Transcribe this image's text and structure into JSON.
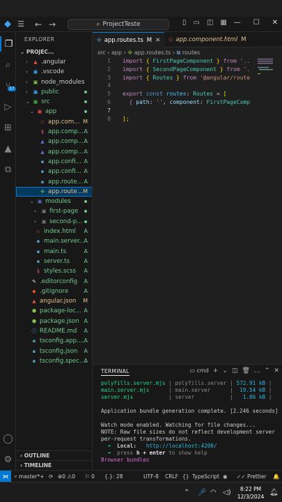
{
  "titlebar": {
    "search_text": "ProjectTeste"
  },
  "activity_bar": {
    "source_control_badge": "37"
  },
  "explorer": {
    "header": "EXPLORER",
    "project_label": "PROJEC...",
    "items": [
      {
        "label": ".angular",
        "status": ""
      },
      {
        "label": ".vscode",
        "status": ""
      },
      {
        "label": "node_modules",
        "status": ""
      },
      {
        "label": "public",
        "status": ""
      },
      {
        "label": "src",
        "status": ""
      },
      {
        "label": "app",
        "status": ""
      },
      {
        "label": "app.com...",
        "status": "M"
      },
      {
        "label": "app.comp...",
        "status": "A"
      },
      {
        "label": "app.comp...",
        "status": "A"
      },
      {
        "label": "app.comp...",
        "status": "A"
      },
      {
        "label": "app.confi...",
        "status": "A"
      },
      {
        "label": "app.confi...",
        "status": "A"
      },
      {
        "label": "app.route...",
        "status": "A"
      },
      {
        "label": "app.route...",
        "status": "M"
      },
      {
        "label": "modules",
        "status": ""
      },
      {
        "label": "first-page",
        "status": ""
      },
      {
        "label": "second-p...",
        "status": ""
      },
      {
        "label": "index.html",
        "status": "A"
      },
      {
        "label": "main.server...",
        "status": "A"
      },
      {
        "label": "main.ts",
        "status": "A"
      },
      {
        "label": "server.ts",
        "status": "A"
      },
      {
        "label": "styles.scss",
        "status": "A"
      },
      {
        "label": ".editorconfig",
        "status": "A"
      },
      {
        "label": ".gitignore",
        "status": "A"
      },
      {
        "label": "angular.json",
        "status": "M"
      },
      {
        "label": "package-loc...",
        "status": "A"
      },
      {
        "label": "package.json",
        "status": "A"
      },
      {
        "label": "README.md",
        "status": "A"
      },
      {
        "label": "tsconfig.app....",
        "status": "A"
      },
      {
        "label": "tsconfig.json",
        "status": "A"
      },
      {
        "label": "tsconfig.spec....",
        "status": "A"
      }
    ],
    "outline_label": "OUTLINE",
    "timeline_label": "TIMELINE"
  },
  "tabs": [
    {
      "label": "app.routes.ts",
      "marker": "M"
    },
    {
      "label": "app.component.html",
      "marker": "M"
    }
  ],
  "breadcrumb": {
    "src": "src",
    "app": "app",
    "file": "app.routes.ts",
    "symbol": "routes"
  },
  "code_lines": [
    "1",
    "2",
    "3",
    "4",
    "5",
    "6",
    "7",
    "8"
  ],
  "code": {
    "l1": [
      "import",
      "{",
      "FirstPageComponent",
      "}",
      "from",
      "'.."
    ],
    "l2": [
      "import",
      "{",
      "SecondPageComponent",
      "}",
      "from",
      "'."
    ],
    "l3": [
      "import",
      "{",
      "Routes",
      "}",
      "from",
      "'@angular/route"
    ],
    "l5": [
      "export",
      "const",
      "routes",
      ":",
      "Routes",
      "=",
      "["
    ],
    "l6": [
      "{",
      "path",
      ":",
      "''",
      ",",
      "component",
      ":",
      "FirstPageComp"
    ],
    "l8": [
      "];"
    ]
  },
  "panel": {
    "title": "TERMINAL",
    "shell": "cmd",
    "lines": [
      {
        "name": "polyfills.server.mjs",
        "sep": "|",
        "desc": "polyfills.server",
        "sep2": "|",
        "size": "572.91 kB",
        "pipe": "|"
      },
      {
        "name": "main.server.mjs",
        "sep": "|",
        "desc": "main.server",
        "sep2": "|",
        "size": "19.54 kB",
        "pipe": "|"
      },
      {
        "name": "server.mjs",
        "sep": "|",
        "desc": "server",
        "sep2": "|",
        "size": "1.86 kB",
        "pipe": "|"
      }
    ],
    "complete": "Application bundle generation complete. [2.246 seconds]",
    "watch": "Watch mode enabled. Watching for file changes...",
    "note1": "NOTE: Raw file sizes do not reflect development server",
    "note2": "per-request transformations.",
    "local_arrow": "➜",
    "local_label": "Local:",
    "local_url": "http://localhost:4200/",
    "help_arrow": "➜",
    "help_pre": "press",
    "help_key": "h + enter",
    "help_post": "to show help",
    "bundles": "Browser bundles"
  },
  "statusbar": {
    "branch": "master*+",
    "errors": "0",
    "warnings": "0",
    "info": "0",
    "position": "{.}: 28",
    "encoding": "UTF-8",
    "eol": "CRLF",
    "language": "TypeScript",
    "prettier": "Prettier"
  },
  "taskbar": {
    "time": "8:22 PM",
    "date": "12/3/2024"
  }
}
